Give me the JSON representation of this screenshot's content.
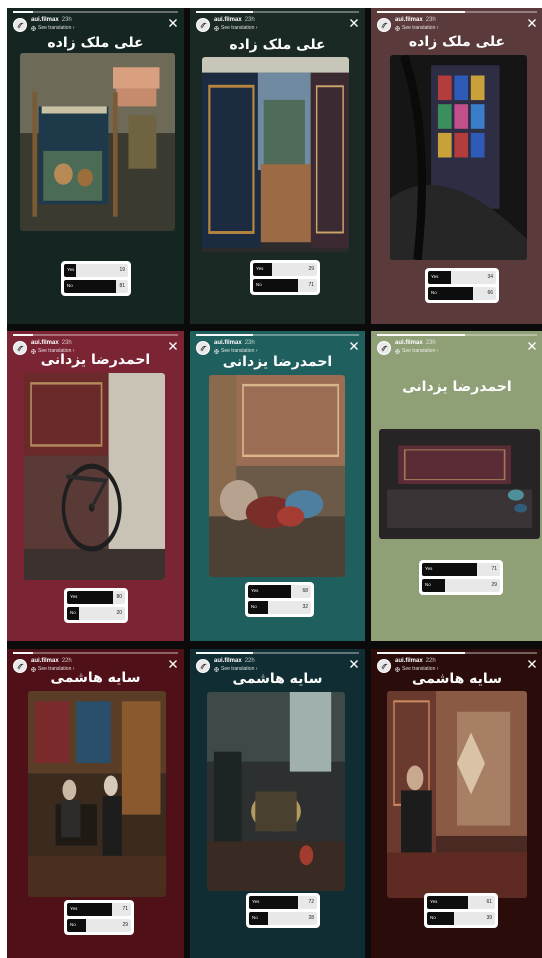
{
  "stories": [
    {
      "username": "aui.filmax",
      "time": "23h",
      "see_translation": "See translation ›",
      "title": "علی ملک زاده",
      "bg": "#152521",
      "photo_theme": "loom",
      "progress": 0.12,
      "poll": {
        "options": [
          {
            "label": "Yes",
            "percent": "19",
            "value": 19
          },
          {
            "label": "No",
            "percent": "81",
            "value": 81
          }
        ]
      }
    },
    {
      "username": "aui.filmax",
      "time": "23h",
      "see_translation": "See translation ›",
      "title": "علی ملک زاده",
      "bg": "#1a2923",
      "photo_theme": "carpets",
      "progress": 0.35,
      "poll": {
        "options": [
          {
            "label": "Yes",
            "percent": "29",
            "value": 29
          },
          {
            "label": "No",
            "percent": "71",
            "value": 71
          }
        ]
      }
    },
    {
      "username": "aui.filmax",
      "time": "23h",
      "see_translation": "See translation ›",
      "title": "علی ملک زاده",
      "bg": "#5b3a3c",
      "photo_theme": "stained-glass",
      "progress": 0.55,
      "poll": {
        "options": [
          {
            "label": "Yes",
            "percent": "34",
            "value": 34
          },
          {
            "label": "No",
            "percent": "66",
            "value": 66
          }
        ]
      }
    },
    {
      "username": "aui.filmax",
      "time": "23h",
      "see_translation": "See translation ›",
      "title": "احمدرضا یزدانی",
      "bg": "#7b2434",
      "photo_theme": "bicycle",
      "progress": 0.12,
      "poll": {
        "options": [
          {
            "label": "Yes",
            "percent": "80",
            "value": 80
          },
          {
            "label": "No",
            "percent": "20",
            "value": 20
          }
        ]
      }
    },
    {
      "username": "aui.filmax",
      "time": "23h",
      "see_translation": "See translation ›",
      "title": "احمدرضا یزدانی",
      "bg": "#1f5f5e",
      "photo_theme": "wool",
      "progress": 0.35,
      "poll": {
        "options": [
          {
            "label": "Yes",
            "percent": "68",
            "value": 68
          },
          {
            "label": "No",
            "percent": "32",
            "value": 32
          }
        ]
      }
    },
    {
      "username": "aui.filmax",
      "time": "23h",
      "see_translation": "See translation ›",
      "title": "احمدرضا یزدانی",
      "bg": "#8f9f76",
      "photo_theme": "rug-dark",
      "progress": 0.55,
      "poll": {
        "options": [
          {
            "label": "Yes",
            "percent": "71",
            "value": 71
          },
          {
            "label": "No",
            "percent": "29",
            "value": 29
          }
        ]
      }
    },
    {
      "username": "aui.filmax",
      "time": "22h",
      "see_translation": "See translation ›",
      "title": "سایه هاشمی",
      "bg": "#4f1117",
      "photo_theme": "shop",
      "progress": 0.12,
      "poll": {
        "options": [
          {
            "label": "Yes",
            "percent": "71",
            "value": 71
          },
          {
            "label": "No",
            "percent": "29",
            "value": 29
          }
        ]
      }
    },
    {
      "username": "aui.filmax",
      "time": "22h",
      "see_translation": "See translation ›",
      "title": "سایه هاشمی",
      "bg": "#0f2d33",
      "photo_theme": "workshop",
      "progress": 0.35,
      "poll": {
        "options": [
          {
            "label": "Yes",
            "percent": "72",
            "value": 72
          },
          {
            "label": "No",
            "percent": "28",
            "value": 28
          }
        ]
      }
    },
    {
      "username": "aui.filmax",
      "time": "22h",
      "see_translation": "See translation ›",
      "title": "سایه هاشمی",
      "bg": "#2a0c0a",
      "photo_theme": "old-man",
      "progress": 0.55,
      "poll": {
        "options": [
          {
            "label": "Yes",
            "percent": "61",
            "value": 61
          },
          {
            "label": "No",
            "percent": "39",
            "value": 39
          }
        ]
      }
    }
  ]
}
